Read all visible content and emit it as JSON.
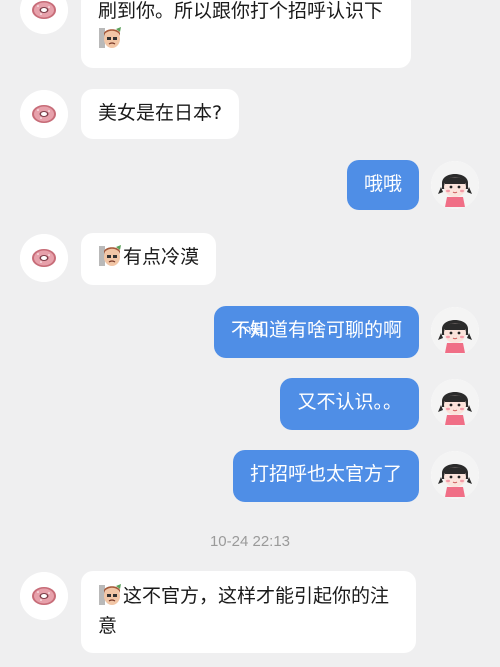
{
  "chat": {
    "messages": [
      {
        "side": "in",
        "text": "刷到你。所以跟你打个招呼认识下",
        "sticker": "girl-sticker-icon"
      },
      {
        "side": "in",
        "text": "美女是在日本?"
      },
      {
        "side": "out",
        "text": "哦哦"
      },
      {
        "side": "in",
        "text": "有点冷漠",
        "sticker": "girl-sticker-icon"
      },
      {
        "side": "out",
        "text": "不知道有啥可聊的啊",
        "overlay": "m娟"
      },
      {
        "side": "out",
        "text": "又不认识。。"
      },
      {
        "side": "out",
        "text": "打招呼也太官方了"
      },
      {
        "side": "in",
        "text_line1": "这不官方，这样才能引起你的注",
        "text_line2": "意",
        "sticker": "girl-sticker-icon"
      }
    ],
    "timestamp": "10-24 22:13"
  },
  "avatars": {
    "left": "donut-avatar-icon",
    "right": "cartoon-girl-avatar-icon"
  },
  "colors": {
    "background": "#efeff0",
    "outgoing_bubble": "#4f8ee6",
    "incoming_bubble": "#ffffff"
  }
}
